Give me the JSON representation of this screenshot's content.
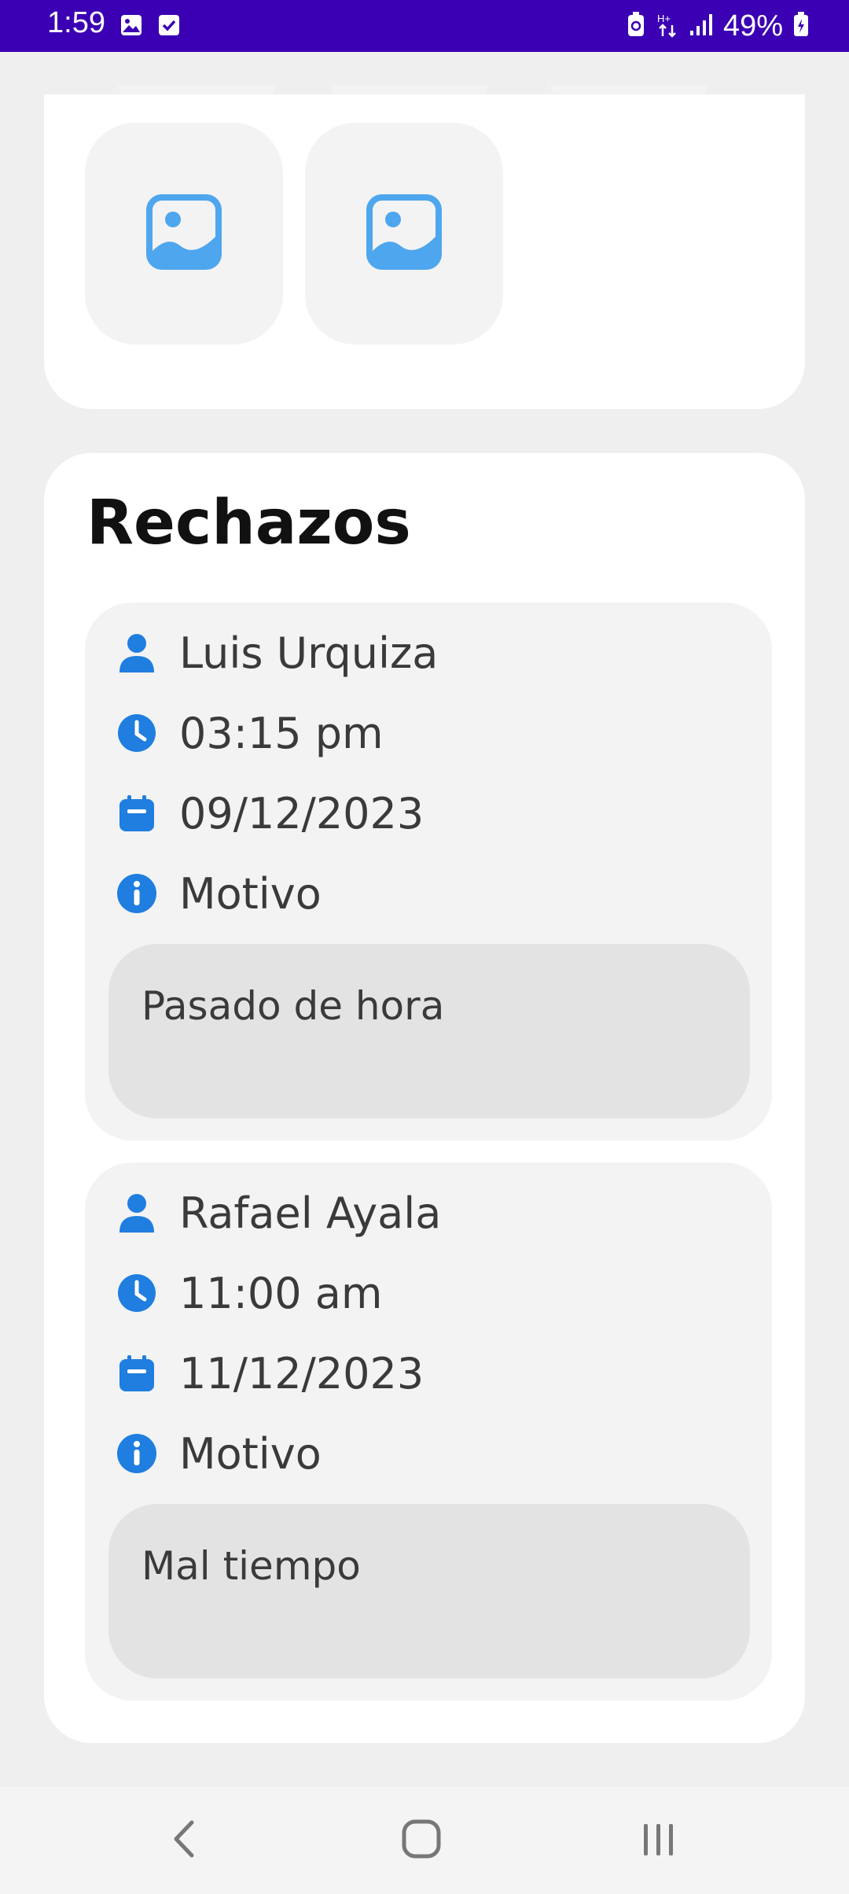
{
  "status_bar": {
    "time": "1:59",
    "battery": "49%",
    "icons": [
      "gallery-icon",
      "checkbox-icon",
      "battery-saver-icon",
      "data-transfer-icon",
      "signal-icon",
      "battery-icon"
    ]
  },
  "images": {
    "tiles": [
      {
        "icon": "image-placeholder-icon"
      },
      {
        "icon": "image-placeholder-icon"
      }
    ]
  },
  "rechazos": {
    "title": "Rechazos",
    "entries": [
      {
        "name": "Luis Urquiza",
        "time": "03:15 pm",
        "date": "09/12/2023",
        "reason_label": "Motivo",
        "reason": "Pasado de hora"
      },
      {
        "name": "Rafael Ayala",
        "time": "11:00 am",
        "date": "11/12/2023",
        "reason_label": "Motivo",
        "reason": "Mal tiempo"
      }
    ]
  },
  "nav": {
    "back": "back-icon",
    "home": "home-icon",
    "recents": "recents-icon"
  },
  "colors": {
    "accent": "#1f7ee0",
    "status_bar": "#3b00b3",
    "image_icon": "#4ea6ee"
  }
}
